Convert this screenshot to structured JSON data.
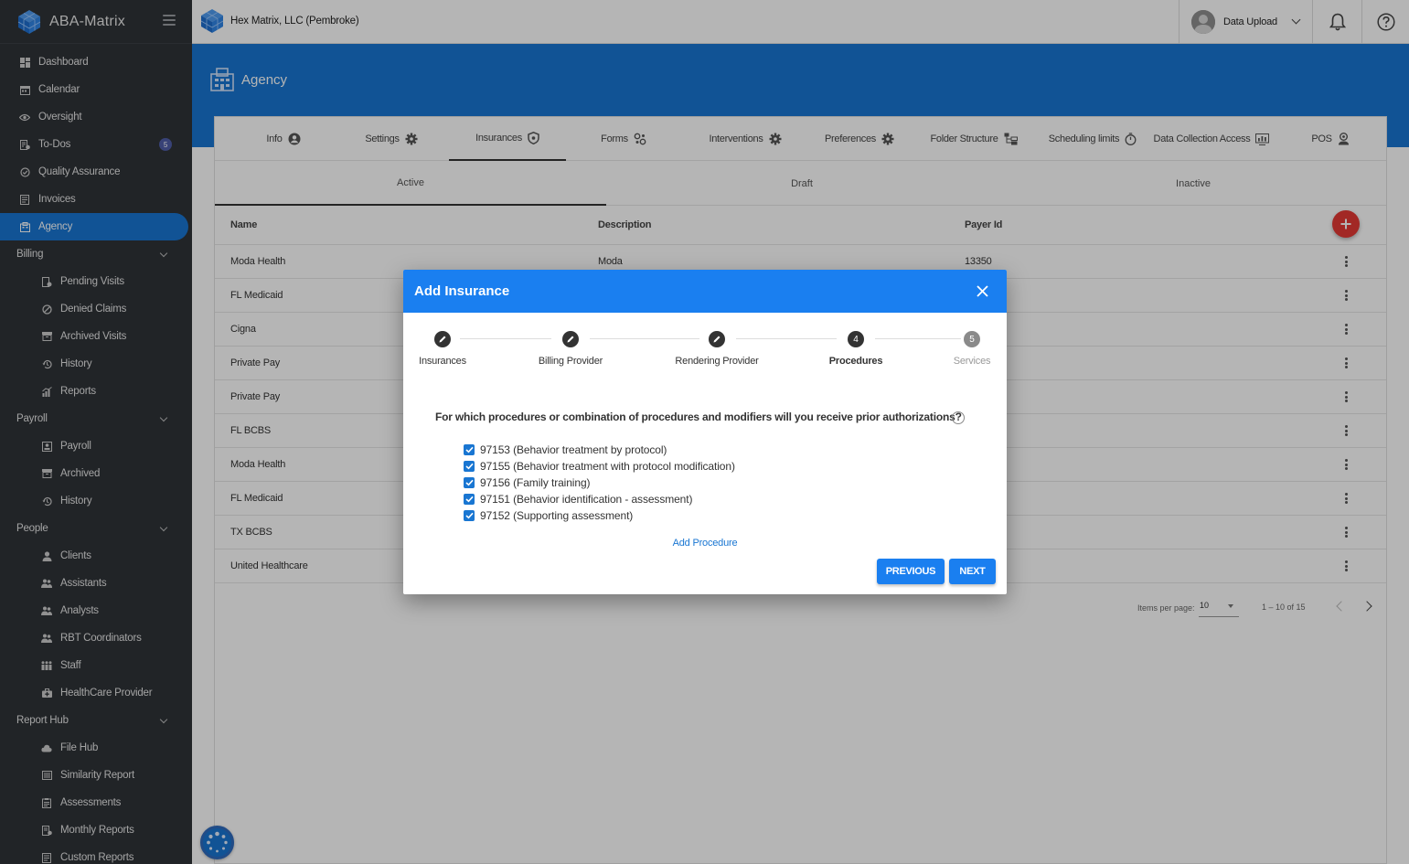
{
  "app": {
    "name": "ABA-Matrix"
  },
  "org": {
    "name": "Hex Matrix, LLC (Pembroke)"
  },
  "user": {
    "label": "Data Upload"
  },
  "sidebar": {
    "items": [
      {
        "label": "Dashboard",
        "icon": "dashboard-icon"
      },
      {
        "label": "Calendar",
        "icon": "calendar-icon"
      },
      {
        "label": "Oversight",
        "icon": "eye-icon"
      },
      {
        "label": "To-Dos",
        "icon": "todo-icon",
        "badge": "5"
      },
      {
        "label": "Quality Assurance",
        "icon": "quality-icon"
      },
      {
        "label": "Invoices",
        "icon": "invoice-icon"
      },
      {
        "label": "Agency",
        "icon": "building-icon",
        "active": true
      }
    ],
    "billing": {
      "label": "Billing",
      "items": [
        "Pending Visits",
        "Denied Claims",
        "Archived Visits",
        "History",
        "Reports"
      ]
    },
    "payroll": {
      "label": "Payroll",
      "items": [
        "Payroll",
        "Archived",
        "History"
      ]
    },
    "people": {
      "label": "People",
      "items": [
        "Clients",
        "Assistants",
        "Analysts",
        "RBT Coordinators",
        "Staff",
        "HealthCare Provider"
      ]
    },
    "report_hub": {
      "label": "Report Hub",
      "items": [
        "File Hub",
        "Similarity Report",
        "Assessments",
        "Monthly Reports",
        "Custom Reports"
      ]
    }
  },
  "page": {
    "title": "Agency"
  },
  "tabs": [
    "Info",
    "Settings",
    "Insurances",
    "Forms",
    "Interventions",
    "Preferences",
    "Folder Structure",
    "Scheduling limits",
    "Data Collection Access",
    "POS"
  ],
  "active_tab": "Insurances",
  "subtabs": [
    "Active",
    "Draft",
    "Inactive"
  ],
  "table": {
    "columns": [
      "Name",
      "Description",
      "Payer Id"
    ],
    "rows": [
      {
        "name": "Moda Health",
        "description": "Moda",
        "payer_id": "13350"
      },
      {
        "name": "FL Medicaid",
        "description": "",
        "payer_id": ""
      },
      {
        "name": "Cigna",
        "description": "",
        "payer_id": ""
      },
      {
        "name": "Private Pay",
        "description": "",
        "payer_id": ""
      },
      {
        "name": "Private Pay",
        "description": "",
        "payer_id": ""
      },
      {
        "name": "FL BCBS",
        "description": "",
        "payer_id": ""
      },
      {
        "name": "Moda Health",
        "description": "",
        "payer_id": ""
      },
      {
        "name": "FL Medicaid",
        "description": "",
        "payer_id": ""
      },
      {
        "name": "TX BCBS",
        "description": "",
        "payer_id": ""
      },
      {
        "name": "United Healthcare",
        "description": "",
        "payer_id": ""
      }
    ]
  },
  "pagination": {
    "label": "Items per page:",
    "per_page": "10",
    "range": "1 – 10 of 15"
  },
  "dialog": {
    "title": "Add Insurance",
    "steps": [
      {
        "label": "Insurances",
        "state": "done"
      },
      {
        "label": "Billing Provider",
        "state": "done"
      },
      {
        "label": "Rendering Provider",
        "state": "done"
      },
      {
        "label": "Procedures",
        "state": "current",
        "number": "4"
      },
      {
        "label": "Services",
        "state": "todo",
        "number": "5"
      }
    ],
    "question": "For which procedures or combination of procedures and modifiers will you receive prior authorizations?",
    "procedures": [
      {
        "label": "97153 (Behavior treatment by protocol)",
        "checked": true
      },
      {
        "label": "97155 (Behavior treatment with protocol modification)",
        "checked": true
      },
      {
        "label": "97156 (Family training)",
        "checked": true
      },
      {
        "label": "97151 (Behavior identification - assessment)",
        "checked": true
      },
      {
        "label": "97152 (Supporting assessment)",
        "checked": true
      }
    ],
    "add_procedure": "Add Procedure",
    "previous": "PREVIOUS",
    "next": "NEXT"
  },
  "colors": {
    "primary": "#1976d2",
    "dialog_header": "#1a7ff0",
    "sidebar": "#2f3338",
    "fab_add": "#e53935"
  }
}
